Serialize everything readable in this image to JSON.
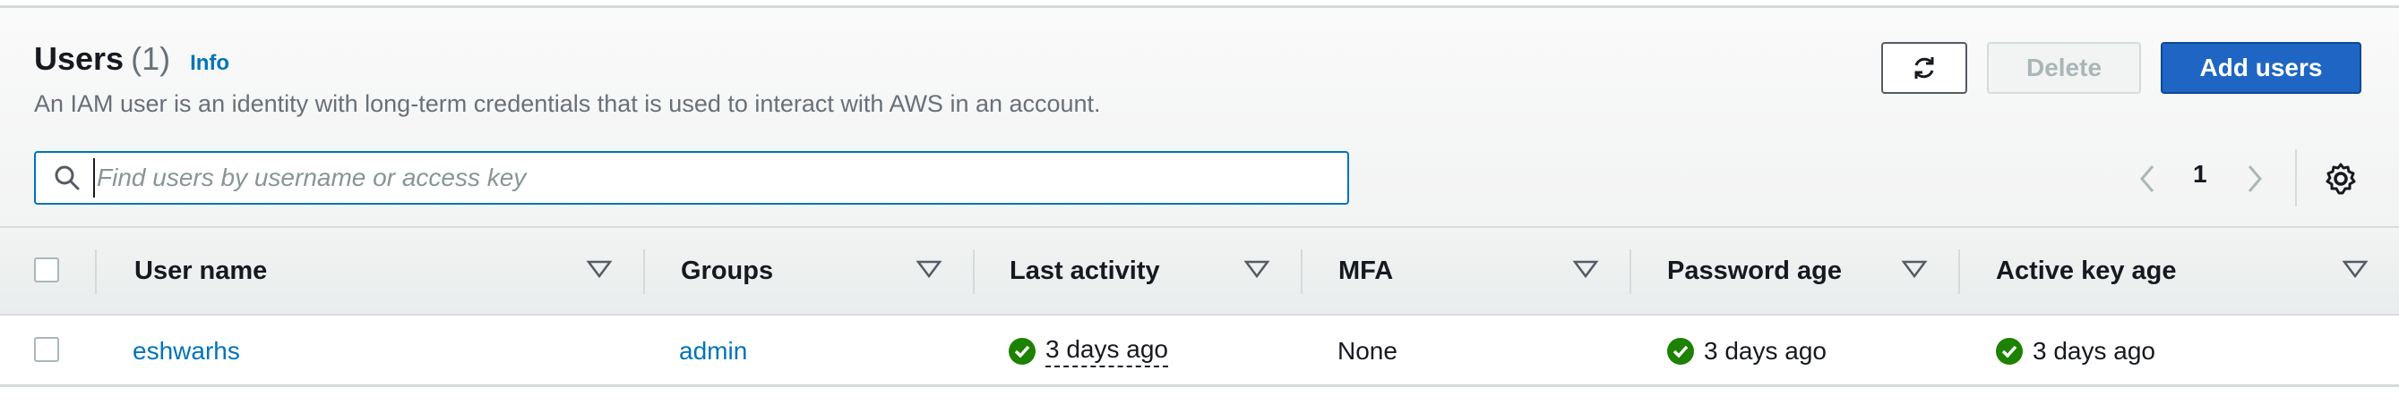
{
  "header": {
    "title": "Users",
    "count": "(1)",
    "info_link": "Info",
    "description": "An IAM user is an identity with long-term credentials that is used to interact with AWS in an account."
  },
  "actions": {
    "refresh_icon": "refresh-icon",
    "delete_label": "Delete",
    "add_label": "Add users"
  },
  "search": {
    "placeholder": "Find users by username or access key",
    "value": ""
  },
  "pagination": {
    "current_page": "1"
  },
  "table": {
    "columns": [
      "User name",
      "Groups",
      "Last activity",
      "MFA",
      "Password age",
      "Active key age"
    ],
    "rows": [
      {
        "user_name": "eshwarhs",
        "groups": "admin",
        "last_activity": "3 days ago",
        "mfa": "None",
        "password_age": "3 days ago",
        "active_key_age": "3 days ago"
      }
    ]
  },
  "colors": {
    "accent": "#0073bb",
    "primary_button": "#1f66c4",
    "status_success": "#1d8102"
  }
}
